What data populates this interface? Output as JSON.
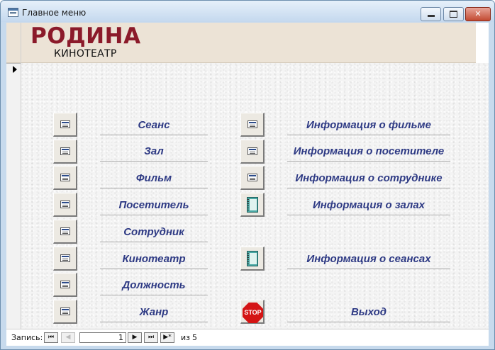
{
  "window": {
    "title": "Главное меню",
    "minimize_icon": "minimize-icon",
    "maximize_icon": "maximize-icon",
    "close_icon": "close-icon"
  },
  "header": {
    "brand": "РОДИНА",
    "subtitle": "КИНОТЕАТР",
    "brand_color": "#8b1a2a",
    "background_color": "#ece3d6"
  },
  "menu": {
    "label_color": "#2e3a84",
    "left_column": [
      {
        "label": "Сеанс",
        "icon": "form-icon"
      },
      {
        "label": "Зал",
        "icon": "form-icon"
      },
      {
        "label": "Фильм",
        "icon": "form-icon"
      },
      {
        "label": "Посетитель",
        "icon": "form-icon"
      },
      {
        "label": "Сотрудник",
        "icon": "form-icon"
      },
      {
        "label": "Кинотеатр",
        "icon": "form-icon"
      },
      {
        "label": "Должность",
        "icon": "form-icon"
      },
      {
        "label": "Жанр",
        "icon": "form-icon"
      }
    ],
    "right_column": [
      {
        "label": "Информация о фильме",
        "icon": "form-icon"
      },
      {
        "label": "Информация о посетителе",
        "icon": "form-icon"
      },
      {
        "label": "Информация о сотруднике",
        "icon": "form-icon"
      },
      {
        "label": "Информация о залах",
        "icon": "notebook-icon"
      },
      {
        "label": "Информация о сеансах",
        "icon": "notebook-icon"
      },
      {
        "label": "Выход",
        "icon": "stop-icon",
        "icon_text": "STOP"
      }
    ]
  },
  "navigation": {
    "record_label": "Запись:",
    "current_record": "1",
    "of_label": "из",
    "total_records": "5",
    "first_icon": "first-record-icon",
    "prev_icon": "previous-record-icon",
    "next_icon": "next-record-icon",
    "last_icon": "last-record-icon",
    "new_icon": "new-record-icon"
  }
}
